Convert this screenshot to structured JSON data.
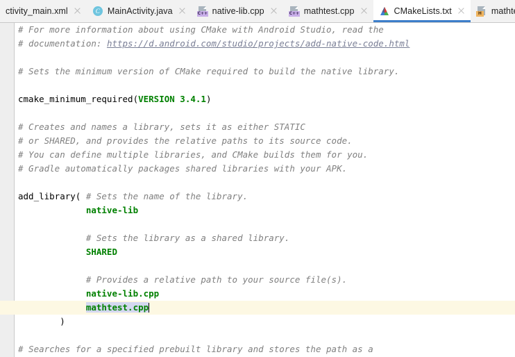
{
  "window": {
    "app": "Android Studio",
    "editor_file": "CMakeLists.txt"
  },
  "tabs": [
    {
      "label": "ctivity_main.xml",
      "icon": "xml-file-icon",
      "active": false,
      "clipped": true,
      "badge": ""
    },
    {
      "label": "MainActivity.java",
      "icon": "java-class-icon",
      "active": false,
      "clipped": false,
      "badge": "C"
    },
    {
      "label": "native-lib.cpp",
      "icon": "cpp-file-icon",
      "active": false,
      "clipped": false,
      "badge": "C++"
    },
    {
      "label": "mathtest.cpp",
      "icon": "cpp-file-icon",
      "active": false,
      "clipped": false,
      "badge": "C++"
    },
    {
      "label": "CMakeLists.txt",
      "icon": "cmake-file-icon",
      "active": true,
      "clipped": false,
      "badge": ""
    },
    {
      "label": "mathtest.h",
      "icon": "header-file-icon",
      "active": false,
      "clipped": false,
      "badge": "H"
    }
  ],
  "colors": {
    "tab_bar_background": "#f2f2f2",
    "active_tab_underline": "#3d7eca",
    "gutter_background": "#eeeeee",
    "editor_background": "#ffffff",
    "comment": "#808080",
    "string_value": "#008000",
    "url": "#7a7f96",
    "current_line_highlight": "#fdf8e3",
    "selection": "#d4d8f0",
    "caret": "#000000"
  },
  "code": {
    "lines": [
      {
        "current": false,
        "tokens": [
          {
            "t": "# For more information about using CMake with Android Studio, read the",
            "c": "cm"
          }
        ]
      },
      {
        "current": false,
        "tokens": [
          {
            "t": "# documentation: ",
            "c": "cm"
          },
          {
            "t": "https://d.android.com/studio/projects/add-native-code.html",
            "c": "url"
          }
        ]
      },
      {
        "current": false,
        "tokens": [
          {
            "t": "",
            "c": "kw"
          }
        ]
      },
      {
        "current": false,
        "tokens": [
          {
            "t": "# Sets the minimum version of CMake required to build the native library.",
            "c": "cm"
          }
        ]
      },
      {
        "current": false,
        "tokens": [
          {
            "t": "",
            "c": "kw"
          }
        ]
      },
      {
        "current": false,
        "tokens": [
          {
            "t": "cmake_minimum_required(",
            "c": "kw"
          },
          {
            "t": "VERSION 3.4.1",
            "c": "num"
          },
          {
            "t": ")",
            "c": "paren"
          }
        ]
      },
      {
        "current": false,
        "tokens": [
          {
            "t": "",
            "c": "kw"
          }
        ]
      },
      {
        "current": false,
        "tokens": [
          {
            "t": "# Creates and names a library, sets it as either STATIC",
            "c": "cm"
          }
        ]
      },
      {
        "current": false,
        "tokens": [
          {
            "t": "# or SHARED, and provides the relative paths to its source code.",
            "c": "cm"
          }
        ]
      },
      {
        "current": false,
        "tokens": [
          {
            "t": "# You can define multiple libraries, and CMake builds them for you.",
            "c": "cm"
          }
        ]
      },
      {
        "current": false,
        "tokens": [
          {
            "t": "# Gradle automatically packages shared libraries with your APK.",
            "c": "cm"
          }
        ]
      },
      {
        "current": false,
        "tokens": [
          {
            "t": "",
            "c": "kw"
          }
        ]
      },
      {
        "current": false,
        "tokens": [
          {
            "t": "add_library( ",
            "c": "kw"
          },
          {
            "t": "# Sets the name of the library.",
            "c": "cm"
          }
        ]
      },
      {
        "current": false,
        "tokens": [
          {
            "t": "             native-lib",
            "c": "val"
          }
        ]
      },
      {
        "current": false,
        "tokens": [
          {
            "t": "",
            "c": "kw"
          }
        ]
      },
      {
        "current": false,
        "tokens": [
          {
            "t": "             ",
            "c": "kw"
          },
          {
            "t": "# Sets the library as a shared library.",
            "c": "cm"
          }
        ]
      },
      {
        "current": false,
        "tokens": [
          {
            "t": "             SHARED",
            "c": "val"
          }
        ]
      },
      {
        "current": false,
        "tokens": [
          {
            "t": "",
            "c": "kw"
          }
        ]
      },
      {
        "current": false,
        "tokens": [
          {
            "t": "             ",
            "c": "kw"
          },
          {
            "t": "# Provides a relative path to your source file(s).",
            "c": "cm"
          }
        ]
      },
      {
        "current": false,
        "tokens": [
          {
            "t": "             native-lib.cpp",
            "c": "val"
          }
        ]
      },
      {
        "current": true,
        "tokens": [
          {
            "t": "             ",
            "c": "kw"
          },
          {
            "t": "mathtest.cpp",
            "c": "sel"
          },
          {
            "t": "",
            "c": "caret"
          }
        ]
      },
      {
        "current": false,
        "tokens": [
          {
            "t": "        ",
            "c": "kw"
          },
          {
            "t": ")",
            "c": "paren"
          }
        ]
      },
      {
        "current": false,
        "tokens": [
          {
            "t": "",
            "c": "kw"
          }
        ]
      },
      {
        "current": false,
        "tokens": [
          {
            "t": "# Searches for a specified prebuilt library and stores the path as a",
            "c": "cm"
          }
        ]
      }
    ]
  }
}
